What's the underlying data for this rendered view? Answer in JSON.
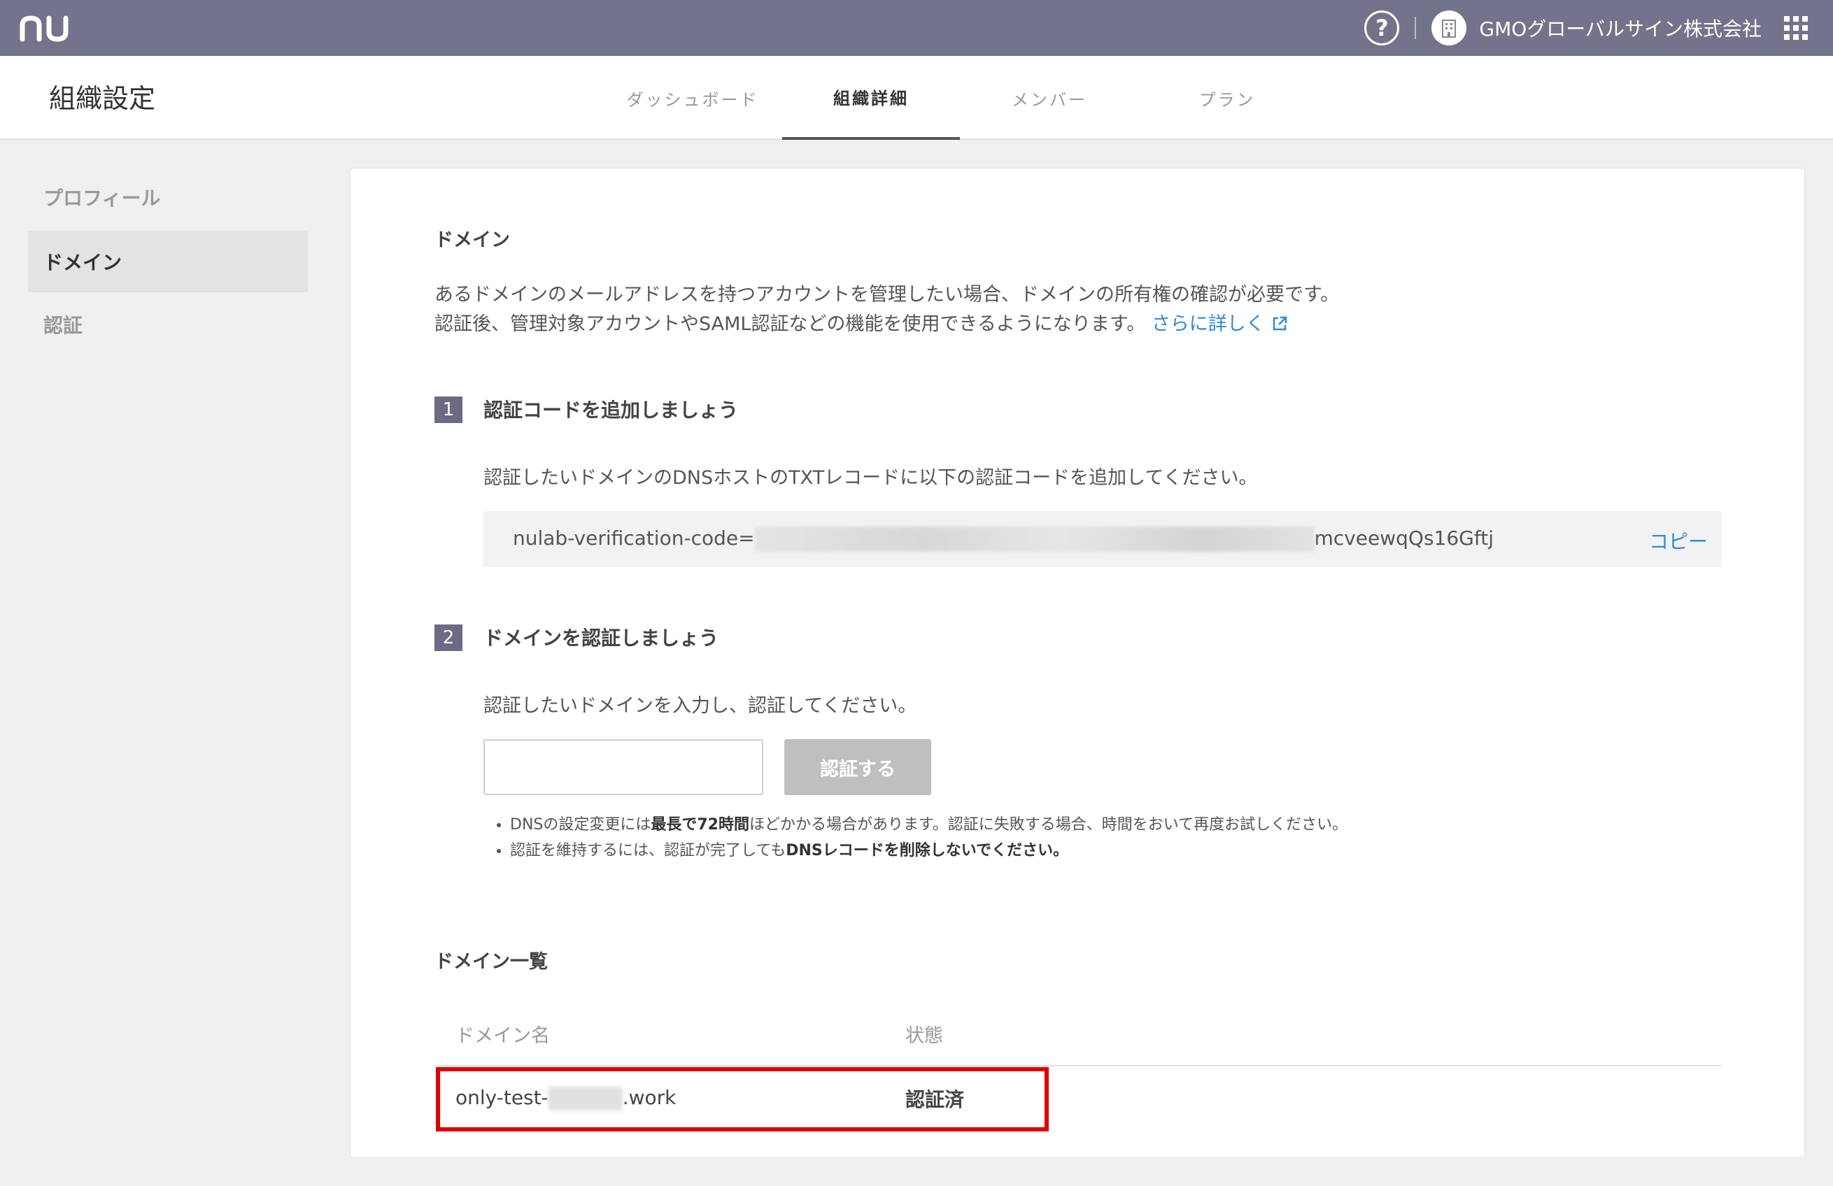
{
  "topbar": {
    "logo": "nu",
    "help_icon": "?",
    "org_name": "GMOグローバルサイン株式会社"
  },
  "header": {
    "title": "組織設定",
    "tabs": [
      {
        "label": "ダッシュボード",
        "active": false
      },
      {
        "label": "組織詳細",
        "active": true
      },
      {
        "label": "メンバー",
        "active": false
      },
      {
        "label": "プラン",
        "active": false
      }
    ]
  },
  "sidebar": {
    "items": [
      {
        "label": "プロフィール",
        "active": false
      },
      {
        "label": "ドメイン",
        "active": true
      },
      {
        "label": "認証",
        "active": false
      }
    ]
  },
  "domain": {
    "title": "ドメイン",
    "description_line1": "あるドメインのメールアドレスを持つアカウントを管理したい場合、ドメインの所有権の確認が必要です。",
    "description_line2": "認証後、管理対象アカウントやSAML認証などの機能を使用できるようになります。",
    "more_link": "さらに詳しく"
  },
  "step1": {
    "number": "1",
    "title": "認証コードを追加しましょう",
    "description": "認証したいドメインのDNSホストのTXTレコードに以下の認証コードを追加してください。",
    "code_prefix": "nulab-verification-code=",
    "code_suffix": "mcveewqQs16Gftj",
    "copy_label": "コピー"
  },
  "step2": {
    "number": "2",
    "title": "ドメインを認証しましょう",
    "description": "認証したいドメインを入力し、認証してください。",
    "input_value": "",
    "button_label": "認証する",
    "note1_a": "DNSの設定変更には",
    "note1_b": "最長で72時間",
    "note1_c": "ほどかかる場合があります。認証に失敗する場合、時間をおいて再度お試しください。",
    "note2_a": "認証を維持するには、認証が完了しても",
    "note2_b": "DNSレコードを削除しないでください。"
  },
  "domain_list": {
    "title": "ドメイン一覧",
    "col_domain": "ドメイン名",
    "col_status": "状態",
    "rows": [
      {
        "domain_prefix": "only-test-",
        "domain_suffix": ".work",
        "status": "認証済"
      }
    ]
  },
  "colors": {
    "topbar": "#74738c",
    "link": "#2f8ad9",
    "highlight": "#e00000"
  }
}
